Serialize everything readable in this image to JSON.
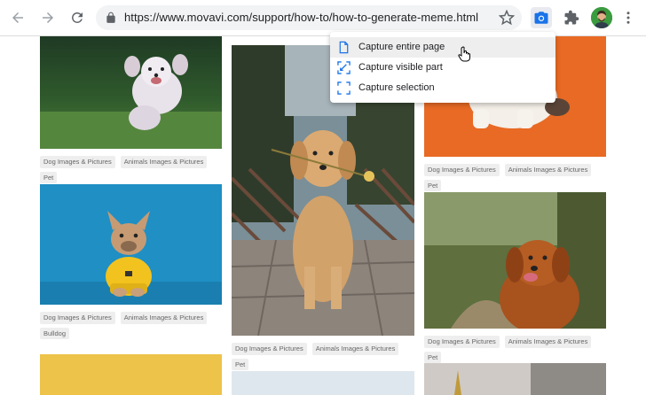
{
  "toolbar": {
    "url": "https://www.movavi.com/support/how-to/how-to-generate-meme.html"
  },
  "capture_menu": {
    "items": [
      {
        "label": "Capture entire page",
        "icon": "page-icon"
      },
      {
        "label": "Capture visible part",
        "icon": "visible-part-icon"
      },
      {
        "label": "Capture selection",
        "icon": "selection-icon"
      }
    ]
  },
  "gallery": {
    "cards": [
      {
        "tags": [
          "Dog Images & Pictures",
          "Animals Images & Pictures",
          "Pet"
        ]
      },
      {
        "tags": [
          "Dog Images & Pictures",
          "Animals Images & Pictures",
          "Bulldog"
        ]
      },
      {
        "tags": [
          "Dog Images & Pictures",
          "Animals Images & Pictures",
          "Pet"
        ]
      },
      {
        "tags": [
          "Dog Images & Pictures",
          "Animals Images & Pictures",
          "Pet"
        ]
      },
      {
        "tags": [
          "Dog Images & Pictures",
          "Animals Images & Pictures",
          "Pet"
        ]
      }
    ]
  },
  "colors": {
    "accent": "#1a73e8",
    "omnibox": "#f1f3f4",
    "tag_bg": "#eeeeee",
    "menu_hover": "#eeeeee"
  }
}
